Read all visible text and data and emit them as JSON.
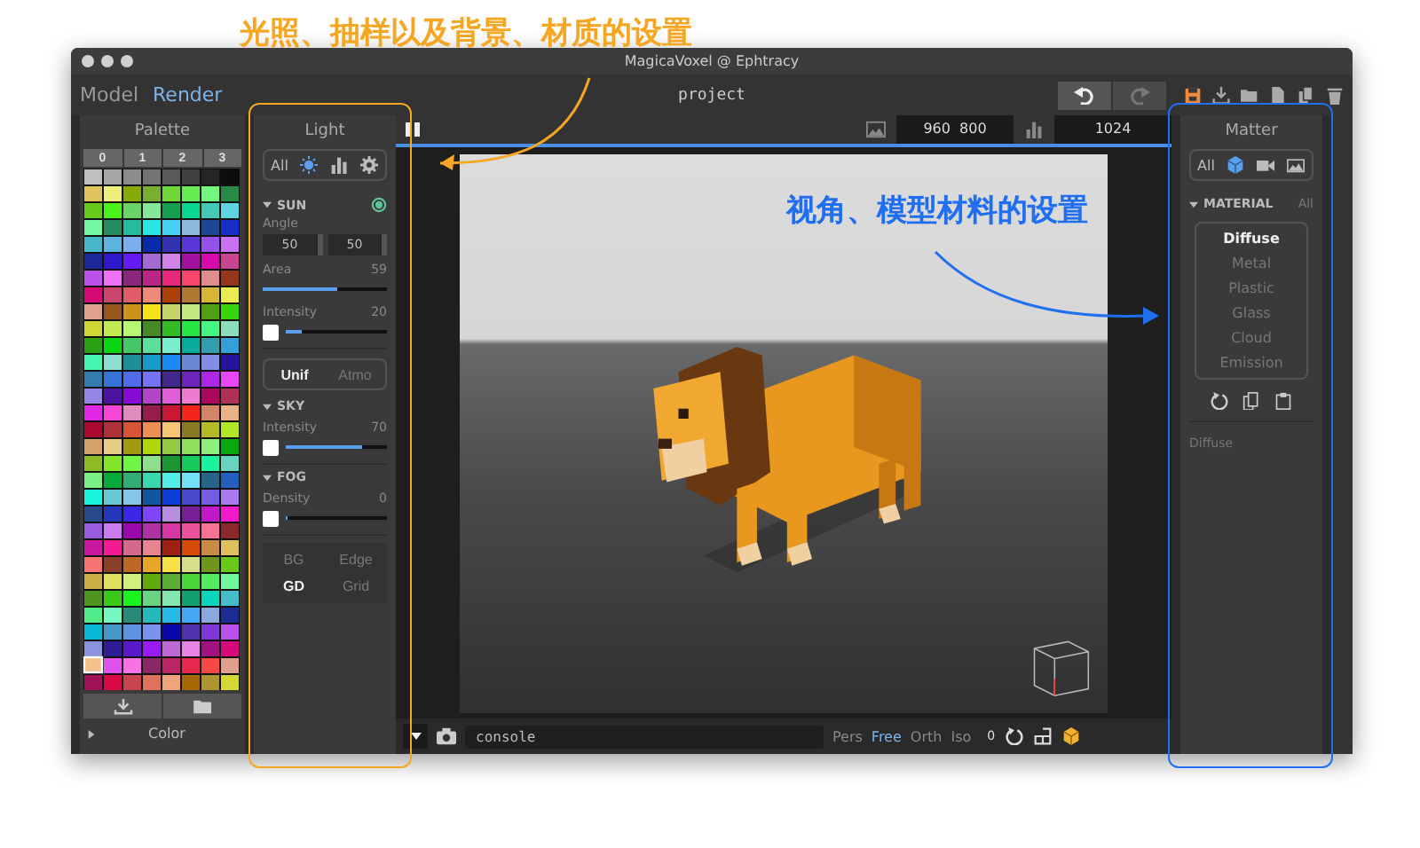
{
  "annotations": [
    {
      "text": "光照、抽样以及背景、材质的设置",
      "color": "#f5a623"
    },
    {
      "text": "视角、模型材料的设置",
      "color": "#1f6ff0"
    }
  ],
  "window": {
    "title": "MagicaVoxel @ Ephtracy"
  },
  "modes": [
    {
      "label": "Model",
      "selected": false
    },
    {
      "label": "Render",
      "selected": true
    }
  ],
  "project": "project",
  "palette": {
    "title": "Palette",
    "pages": [
      "0",
      "1",
      "2",
      "3"
    ],
    "footer": "Color",
    "expanded": false
  },
  "light": {
    "title": "Light",
    "filters": [
      {
        "kind": "text",
        "label": "All",
        "selected": false
      },
      {
        "kind": "sun",
        "selected": true
      },
      {
        "kind": "chart",
        "selected": false
      },
      {
        "kind": "gear",
        "selected": false
      }
    ],
    "sun": {
      "title": "SUN",
      "expanded": true,
      "enabled": true,
      "angle_label": "Angle",
      "angle": [
        "50",
        "50"
      ],
      "sliders": [
        {
          "label": "Area",
          "value": "59",
          "level": 0.6,
          "swatch": false
        },
        {
          "label": "Intensity",
          "value": "20",
          "level": 0.15,
          "swatch": true
        }
      ]
    },
    "scatter": [
      {
        "label": "Unif",
        "selected": true
      },
      {
        "label": "Atmo",
        "selected": false
      }
    ],
    "sky": {
      "title": "SKY",
      "expanded": true,
      "sliders": [
        {
          "label": "Intensity",
          "value": "70",
          "level": 0.75,
          "swatch": true
        }
      ]
    },
    "fog": {
      "title": "FOG",
      "expanded": true,
      "sliders": [
        {
          "label": "Density",
          "value": "0",
          "level": 0,
          "swatch": true
        }
      ]
    },
    "options": [
      {
        "label": "BG",
        "selected": false
      },
      {
        "label": "Edge",
        "selected": false
      },
      {
        "label": "GD",
        "selected": true
      },
      {
        "label": "Grid",
        "selected": false
      }
    ]
  },
  "viewport": {
    "size": [
      "960",
      "800"
    ],
    "samples": "1024",
    "console": {
      "placeholder": "console"
    },
    "views": [
      {
        "label": "Pers",
        "selected": false
      },
      {
        "label": "Free",
        "selected": true
      },
      {
        "label": "Orth",
        "selected": false
      },
      {
        "label": "Iso",
        "selected": false
      }
    ],
    "zoom": "0"
  },
  "matter": {
    "title": "Matter",
    "filters": [
      {
        "kind": "text",
        "label": "All",
        "selected": false
      },
      {
        "kind": "cube",
        "selected": true
      },
      {
        "kind": "camera",
        "selected": false
      },
      {
        "kind": "image",
        "selected": false
      }
    ],
    "section": "MATERIAL",
    "expanded": true,
    "section_action": "All",
    "materials": [
      {
        "label": "Diffuse",
        "selected": true
      },
      {
        "label": "Metal",
        "selected": false
      },
      {
        "label": "Plastic",
        "selected": false
      },
      {
        "label": "Glass",
        "selected": false
      },
      {
        "label": "Cloud",
        "selected": false
      },
      {
        "label": "Emission",
        "selected": false
      }
    ],
    "current": "Diffuse"
  }
}
